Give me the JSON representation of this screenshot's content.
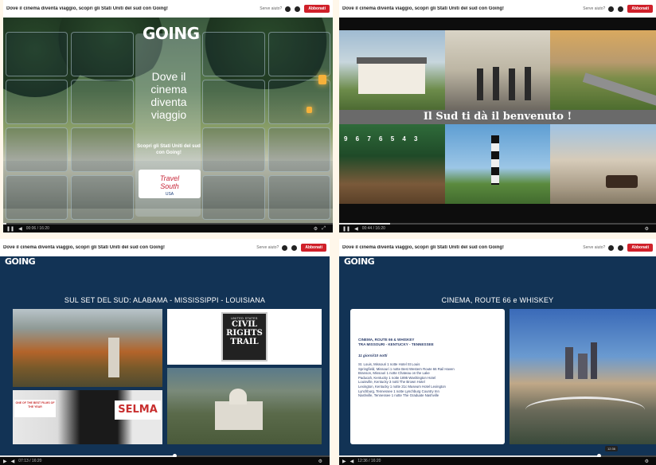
{
  "header": {
    "title": "Dove il cinema diventa viaggio, scopri gli Stati Uniti del sud con Going!",
    "question": "Serve aiuto?",
    "subscribe_label": "Abbonati"
  },
  "panel1": {
    "logo": "GOING",
    "headline": "Dove il cinema diventa viaggio",
    "subline": "Scopri gli Stati Uniti del sud con Going!",
    "partner_line1": "Travel",
    "partner_line2": "South",
    "partner_line3": "USA",
    "time": "00:06 / 16:20",
    "progress": 0.01
  },
  "panel2": {
    "banner": "Il Sud ti dà il benvenuto !",
    "gate_numbers": "9 6 7 6 5 4 3",
    "time": "00:44 / 16:20",
    "progress": 0.16
  },
  "panel3": {
    "logo": "GOING",
    "title": "SUL SET DEL SUD: ALABAMA - MISSISSIPPI - LOUISIANA",
    "crt_us": "UNITED STATES",
    "crt_word1": "CIVIL",
    "crt_word2": "RIGHTS",
    "crt_word3": "TRAIL",
    "poster_tag": "ONE OF THE BEST FILMS OF THE YEAR",
    "poster_title": "SELMA",
    "time": "07:13 / 16:20",
    "progress": 0.53
  },
  "panel4": {
    "logo": "GOING",
    "title": "CINEMA, ROUTE 66 e WHISKEY",
    "itinerary_heading1": "CINEMA, ROUTE 66 & WHISKEY",
    "itinerary_heading2": "TRA MISSOURI - KENTUCKY - TENNESSEE",
    "days": "11 giorni/10 notti",
    "lines": [
      "St. Louis, Missouri 1 notte Hotel St Louis",
      "Springfield, Missouri 1 notte Best Western Route 66 Rail Haven",
      "Branson, Missouri 1 notte Chateau on the Lake",
      "Paducah, Kentucky 1 notte 1895 Washington Hotel",
      "Louisville, Kentucky 3 notti The Brown Hotel",
      "Lexington, Kentucky 1 notte 21c Museum Hotel Lexington",
      "Lynchburg, Tennessee 1 notte Lynchburg Country Inn",
      "Nashville, Tennessee 1 notte The Graduate Nashville"
    ],
    "tooltip": "12:36",
    "time": "12:36 / 16:20",
    "progress": 0.82
  }
}
